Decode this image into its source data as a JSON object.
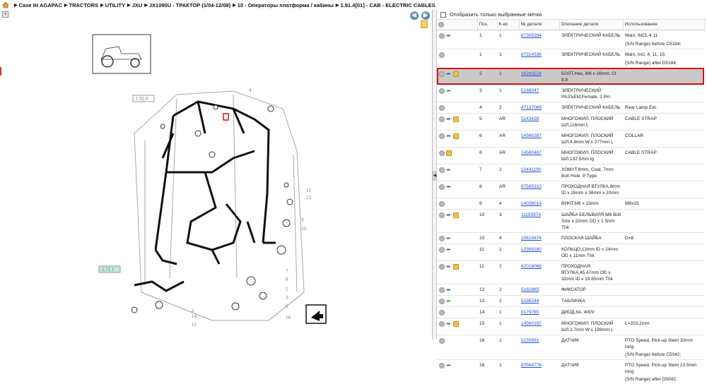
{
  "breadcrumb": [
    "Case IH AGAPAC",
    "TRACTORS",
    "UTILITY",
    "JXU",
    "JX1090U - ТРАКТОР (1/04-12/08)",
    "10 - Операторы платформа / кабины",
    "1.91.4[01] - CAB - ELECTRIC CABLES"
  ],
  "nav": {
    "back": "◀",
    "forward": "▶"
  },
  "diagram": {
    "callouts": [
      "1.92.0",
      "1.71.1"
    ],
    "numbers": [
      "4",
      "1",
      "11",
      "13",
      "9",
      "10",
      "7",
      "8",
      "5",
      "3",
      "6",
      "2",
      "14",
      "12",
      "16"
    ]
  },
  "filter_label": "Отобразить только выбранные метки",
  "columns": [
    "Поз.",
    "К-во",
    "№ детали",
    "Описание детали",
    "Использование"
  ],
  "rows": [
    {
      "icons": [
        "circle",
        "blue"
      ],
      "pos": "1",
      "qty": "1",
      "part": "87305294",
      "desc": "ЭЛЕКТРИЧЕСКИЙ КАБЕЛЬ",
      "usage": "Main, INCL 4,11",
      "sub": "(S/N Range) before C5184;"
    },
    {
      "icons": [
        "circle"
      ],
      "pos": "1",
      "qty": "1",
      "part": "87314336",
      "desc": "ЭЛЕКТРИЧЕСКИЙ КАБЕЛЬ",
      "usage": "Main, Incl. 4, 11, 15",
      "sub": "(S/N Range) after D5184;"
    },
    {
      "icons": [
        "circle",
        "blue",
        "box"
      ],
      "pos": "2",
      "qty": "1",
      "part": "16243224",
      "desc": "БОЛТ,Hex, M8 x 16mm, Cl 8.8",
      "usage": "",
      "selected": true
    },
    {
      "icons": [
        "circle",
        "green"
      ],
      "pos": "3",
      "qty": "1",
      "part": "5168047",
      "desc": "ЭЛЕКТРИЧЕСКИЙ РАЗЪЕМ,Female, 2 Pin",
      "usage": ""
    },
    {
      "icons": [
        "circle"
      ],
      "pos": "4",
      "qty": "2",
      "part": "47137069",
      "desc": "ЭЛЕКТРИЧЕСКИЙ КАБЕЛЬ",
      "usage": "Rear Lamp Ext."
    },
    {
      "icons": [
        "circle",
        "blue",
        "box"
      ],
      "pos": "5",
      "qty": "AR",
      "part": "5143428",
      "desc": "МНОГОЖИЛ. ПЛОСКИЙ ШЛ,116mm L",
      "usage": "CABLE STRAP"
    },
    {
      "icons": [
        "circle",
        "blue",
        "box"
      ],
      "pos": "6",
      "qty": "AR",
      "part": "14560287",
      "desc": "МНОГОЖИЛ. ПЛОСКИЙ ШЛ,4.8mm W x 277mm L",
      "usage": "COLLAR"
    },
    {
      "icons": [
        "circle",
        "box"
      ],
      "pos": "6",
      "qty": "AR",
      "part": "14560487",
      "desc": "МНОГОЖИЛ. ПЛОСКИЙ ШЛ,132.5mm lg",
      "usage": "CABLE STRAP"
    },
    {
      "icons": [
        "circle",
        "green"
      ],
      "pos": "7",
      "qty": "2",
      "part": "10441190",
      "desc": "ХОМУТ,8mm, Coat, 7mm Bolt Hole, P Type",
      "usage": ""
    },
    {
      "icons": [
        "circle",
        "blue"
      ],
      "pos": "8",
      "qty": "AR",
      "part": "87565310",
      "desc": "ПРОХОДНАЯ ВТУЛКА,8mm ID x 28mm x 38mm x 10mm",
      "usage": ""
    },
    {
      "icons": [
        "circle"
      ],
      "pos": "9",
      "qty": "4",
      "part": "14038014",
      "desc": "ВИНТ,M8 x 15mm",
      "usage": "M8x15"
    },
    {
      "icons": [
        "circle",
        "blue",
        "box"
      ],
      "pos": "10",
      "qty": "3",
      "part": "11193974",
      "desc": "ШАЙБА БЕЛЬВИЛЯ,M8 Bolt Size x 22mm OD x 1.5mm Thk",
      "usage": ""
    },
    {
      "icons": [
        "circle",
        "green"
      ],
      "pos": "10",
      "qty": "4",
      "part": "10615674",
      "desc": "ПЛОСКАЯ ШАЙБА",
      "usage": "D=8"
    },
    {
      "icons": [
        "circle",
        "blue"
      ],
      "pos": "11",
      "qty": "1",
      "part": "10389180",
      "desc": "КОЛЬЦО,12mm ID x 24mm OD x 11mm Thk",
      "usage": ""
    },
    {
      "icons": [
        "circle",
        "blue",
        "box"
      ],
      "pos": "11",
      "qty": "2",
      "part": "82016068",
      "desc": "ПРОХОДНАЯ ВТУЛКА,45.47mm OD x 32mm ID x 19.65mm Thk",
      "usage": ""
    },
    {
      "icons": [
        "circle",
        "blue"
      ],
      "pos": "12",
      "qty": "2",
      "part": "5182865",
      "desc": "ФИКСАТОР",
      "usage": ""
    },
    {
      "icons": [
        "circle",
        "green"
      ],
      "pos": "13",
      "qty": "2",
      "part": "5198244",
      "desc": "ТАБЛИЧКА",
      "usage": ""
    },
    {
      "icons": [
        "circle"
      ],
      "pos": "14",
      "qty": "1",
      "part": "5179765",
      "desc": "ДИОД,6A, 400V",
      "usage": ""
    },
    {
      "icons": [
        "circle",
        "blue",
        "box"
      ],
      "pos": "15",
      "qty": "1",
      "part": "14560187",
      "desc": "МНОГОЖИЛ. ПЛОСКИЙ ШЛ,3.7mm W x 199mm L",
      "usage": "L=203.2mm"
    },
    {
      "icons": [
        "circle"
      ],
      "pos": "16",
      "qty": "1",
      "part": "5150991",
      "desc": "ДАТЧИК",
      "usage": "PTO Speed, Pick-up Stem 30mm long",
      "sub": "(S/N Range) before C5042;"
    },
    {
      "icons": [
        "circle",
        "blue"
      ],
      "pos": "16",
      "qty": "1",
      "part": "87564776",
      "desc": "ДАТЧИК",
      "usage": "PTO Speed, Pick-up Stem 23.5mm long",
      "sub": "(S/N Range) after D5042;"
    }
  ]
}
